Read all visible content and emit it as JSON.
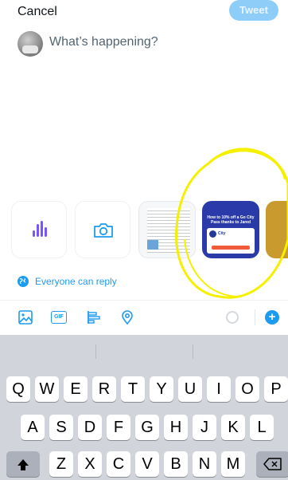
{
  "header": {
    "cancel_label": "Cancel",
    "tweet_label": "Tweet"
  },
  "composer": {
    "placeholder": "What’s happening?",
    "avatar_icon": "user-avatar"
  },
  "media": {
    "tiles": [
      {
        "icon": "voice-waveform-icon",
        "kind": "voice"
      },
      {
        "icon": "camera-icon",
        "kind": "camera"
      },
      {
        "kind": "photo"
      },
      {
        "kind": "photo",
        "title": "How to 10% off a Go City Pass thanks to Jared",
        "logo_label": "City"
      },
      {
        "kind": "photo"
      }
    ],
    "annotation_color": "#f4f000"
  },
  "reply": {
    "label": "Everyone can reply",
    "icon": "globe-icon"
  },
  "toolbar": {
    "icons": [
      "image-icon",
      "gif-icon",
      "poll-icon",
      "location-icon"
    ],
    "gif_text": "GIF",
    "add_icon": "+",
    "accent": "#1d9bf0"
  },
  "keyboard": {
    "row1": [
      "Q",
      "W",
      "E",
      "R",
      "T",
      "Y",
      "U",
      "I",
      "O",
      "P"
    ],
    "row2": [
      "A",
      "S",
      "D",
      "F",
      "G",
      "H",
      "J",
      "K",
      "L"
    ],
    "row3": [
      "Z",
      "X",
      "C",
      "V",
      "B",
      "N",
      "M"
    ],
    "shift_icon": "shift-icon",
    "backspace_icon": "backspace-icon"
  }
}
